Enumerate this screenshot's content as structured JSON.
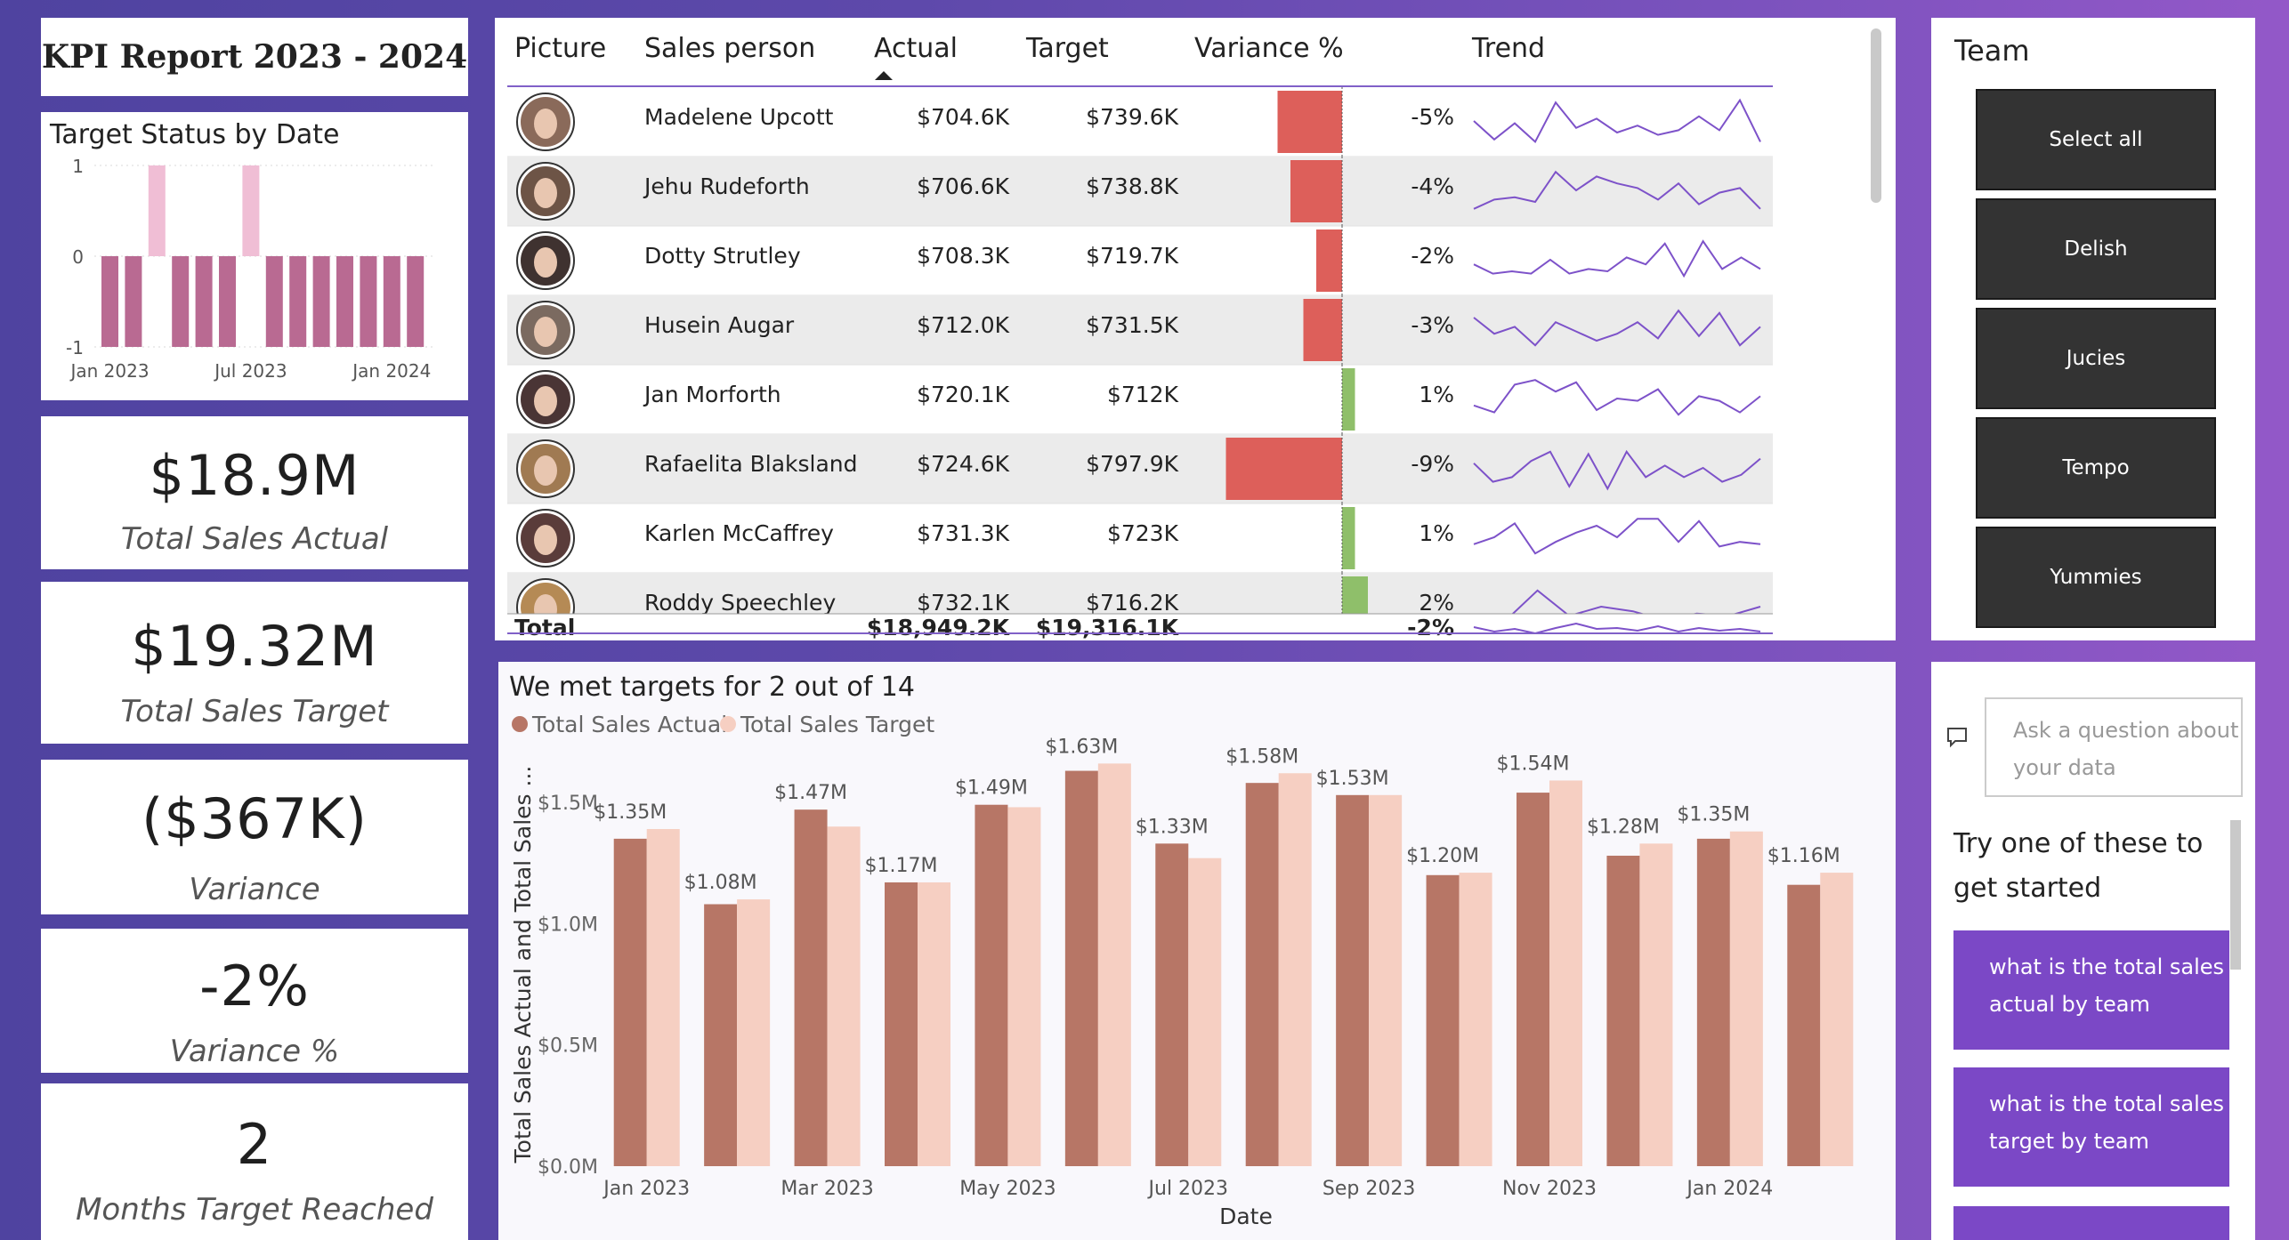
{
  "report": {
    "title": "KPI Report 2023 - 2024"
  },
  "target_status": {
    "title": "Target Status by Date",
    "y_ticks": [
      "1",
      "0",
      "-1"
    ],
    "x_ticks": [
      "Jan 2023",
      "Jul 2023",
      "Jan 2024"
    ],
    "chart_data": {
      "type": "bar",
      "categories": [
        "Jan 2023",
        "Feb 2023",
        "Mar 2023",
        "Apr 2023",
        "May 2023",
        "Jun 2023",
        "Jul 2023",
        "Aug 2023",
        "Sep 2023",
        "Oct 2023",
        "Nov 2023",
        "Dec 2023",
        "Jan 2024",
        "Feb 2024"
      ],
      "values": [
        -1,
        -1,
        1,
        -1,
        -1,
        -1,
        1,
        -1,
        -1,
        -1,
        -1,
        -1,
        -1,
        -1
      ],
      "ylim": [
        -1,
        1
      ],
      "colors": {
        "met": "#f0bed5",
        "missed": "#b96a92"
      }
    }
  },
  "kpis": [
    {
      "value": "$18.9M",
      "label": "Total Sales Actual"
    },
    {
      "value": "$19.32M",
      "label": "Total Sales Target"
    },
    {
      "value": "($367K)",
      "label": "Variance"
    },
    {
      "value": "-2%",
      "label": "Variance %"
    },
    {
      "value": "2",
      "label": "Months Target Reached"
    }
  ],
  "table": {
    "headers": {
      "picture": "Picture",
      "person": "Sales person",
      "actual": "Actual",
      "target": "Target",
      "variance": "Variance %",
      "trend": "Trend"
    },
    "rows": [
      {
        "name": "Madelene Upcott",
        "actual": "$704.6K",
        "target": "$739.6K",
        "variance": "-5%",
        "var_value": -5,
        "avatar_color": "#8a6a5a",
        "trend": [
          0.5,
          0.1,
          0.45,
          0.05,
          0.9,
          0.35,
          0.55,
          0.25,
          0.4,
          0.2,
          0.3,
          0.6,
          0.3,
          0.95,
          0.05
        ]
      },
      {
        "name": "Jehu Rudeforth",
        "actual": "$706.6K",
        "target": "$738.8K",
        "variance": "-4%",
        "var_value": -4,
        "avatar_color": "#6d5446",
        "trend": [
          0.1,
          0.3,
          0.35,
          0.25,
          0.9,
          0.5,
          0.8,
          0.65,
          0.55,
          0.3,
          0.65,
          0.2,
          0.45,
          0.55,
          0.1
        ]
      },
      {
        "name": "Dotty Strutley",
        "actual": "$708.3K",
        "target": "$719.7K",
        "variance": "-2%",
        "var_value": -2,
        "avatar_color": "#3f3230",
        "trend": [
          0.4,
          0.2,
          0.25,
          0.2,
          0.5,
          0.2,
          0.3,
          0.25,
          0.55,
          0.4,
          0.85,
          0.15,
          0.9,
          0.3,
          0.55,
          0.3
        ]
      },
      {
        "name": "Husein Augar",
        "actual": "$712.0K",
        "target": "$731.5K",
        "variance": "-3%",
        "var_value": -3,
        "avatar_color": "#7b6a60",
        "trend": [
          0.75,
          0.4,
          0.55,
          0.15,
          0.65,
          0.45,
          0.25,
          0.4,
          0.65,
          0.3,
          0.9,
          0.35,
          0.85,
          0.15,
          0.55
        ]
      },
      {
        "name": "Jan Morforth",
        "actual": "$720.1K",
        "target": "$712K",
        "variance": "1%",
        "var_value": 1,
        "avatar_color": "#4a3535",
        "trend": [
          0.35,
          0.2,
          0.8,
          0.9,
          0.65,
          0.85,
          0.25,
          0.5,
          0.45,
          0.7,
          0.15,
          0.55,
          0.45,
          0.2,
          0.55
        ]
      },
      {
        "name": "Rafaelita Blaksland",
        "actual": "$724.6K",
        "target": "$797.9K",
        "variance": "-9%",
        "var_value": -9,
        "avatar_color": "#a07a52",
        "trend": [
          0.6,
          0.2,
          0.3,
          0.65,
          0.85,
          0.1,
          0.8,
          0.05,
          0.85,
          0.3,
          0.55,
          0.3,
          0.5,
          0.2,
          0.35,
          0.7
        ]
      },
      {
        "name": "Karlen McCaffrey",
        "actual": "$731.3K",
        "target": "$723K",
        "variance": "1%",
        "var_value": 1,
        "avatar_color": "#5a3c3a",
        "trend": [
          0.35,
          0.5,
          0.8,
          0.15,
          0.4,
          0.6,
          0.75,
          0.5,
          0.9,
          0.9,
          0.4,
          0.85,
          0.3,
          0.4,
          0.35
        ]
      },
      {
        "name": "Roddy Speechley",
        "actual": "$732.1K",
        "target": "$716.2K",
        "variance": "2%",
        "var_value": 2,
        "avatar_color": "#b58a55",
        "trend": [
          0.2,
          0.2,
          0.85,
          0.3,
          0.5,
          0.4,
          0.2,
          0.35,
          0.3,
          0.5
        ]
      }
    ],
    "total": {
      "label": "Total",
      "actual": "$18,949.2K",
      "target": "$19,316.1K",
      "variance": "-2%",
      "trend": [
        0.55,
        0.3,
        0.45,
        0.2,
        0.5,
        0.75,
        0.45,
        0.5,
        0.35,
        0.6,
        0.3,
        0.5,
        0.35,
        0.45,
        0.3
      ]
    },
    "colors": {
      "negative": "#dd5f5a",
      "positive": "#8fbf6a",
      "trend": "#7d52c9"
    }
  },
  "team": {
    "title": "Team",
    "options": [
      "Select all",
      "Delish",
      "Jucies",
      "Tempo",
      "Yummies"
    ]
  },
  "main_chart": {
    "title": "We met targets for 2 out of 14",
    "legend": [
      "Total Sales Actual",
      "Total Sales Target"
    ],
    "ylabel": "Total Sales Actual and Total Sales ...",
    "xlabel": "Date",
    "y_ticks": [
      "$0.0M",
      "$0.5M",
      "$1.0M",
      "$1.5M"
    ],
    "x_ticks": [
      "Jan 2023",
      "Mar 2023",
      "May 2023",
      "Jul 2023",
      "Sep 2023",
      "Nov 2023",
      "Jan 2024"
    ],
    "chart_data": {
      "type": "bar",
      "categories": [
        "Jan 2023",
        "Feb 2023",
        "Mar 2023",
        "Apr 2023",
        "May 2023",
        "Jun 2023",
        "Jul 2023",
        "Aug 2023",
        "Sep 2023",
        "Oct 2023",
        "Nov 2023",
        "Dec 2023",
        "Jan 2024",
        "Feb 2024"
      ],
      "series": [
        {
          "name": "Total Sales Actual",
          "values": [
            1.35,
            1.08,
            1.47,
            1.17,
            1.49,
            1.63,
            1.33,
            1.58,
            1.53,
            1.2,
            1.54,
            1.28,
            1.35,
            1.16
          ],
          "labels": [
            "$1.35M",
            "$1.08M",
            "$1.47M",
            "$1.17M",
            "$1.49M",
            "$1.63M",
            "$1.33M",
            "$1.58M",
            "$1.53M",
            "$1.20M",
            "$1.54M",
            "$1.28M",
            "$1.35M",
            "$1.16M"
          ],
          "color": "#b77666"
        },
        {
          "name": "Total Sales Target",
          "values": [
            1.39,
            1.1,
            1.4,
            1.17,
            1.48,
            1.66,
            1.27,
            1.62,
            1.53,
            1.21,
            1.59,
            1.33,
            1.38,
            1.21
          ],
          "color": "#f6cfc2"
        }
      ],
      "ylim": [
        0,
        1.72
      ]
    }
  },
  "qa": {
    "placeholder": "Ask a question about your data",
    "prompt": "Try one of these to get started",
    "suggestions": [
      "what is the total sales actual by team",
      "what is the total sales target by team"
    ]
  }
}
